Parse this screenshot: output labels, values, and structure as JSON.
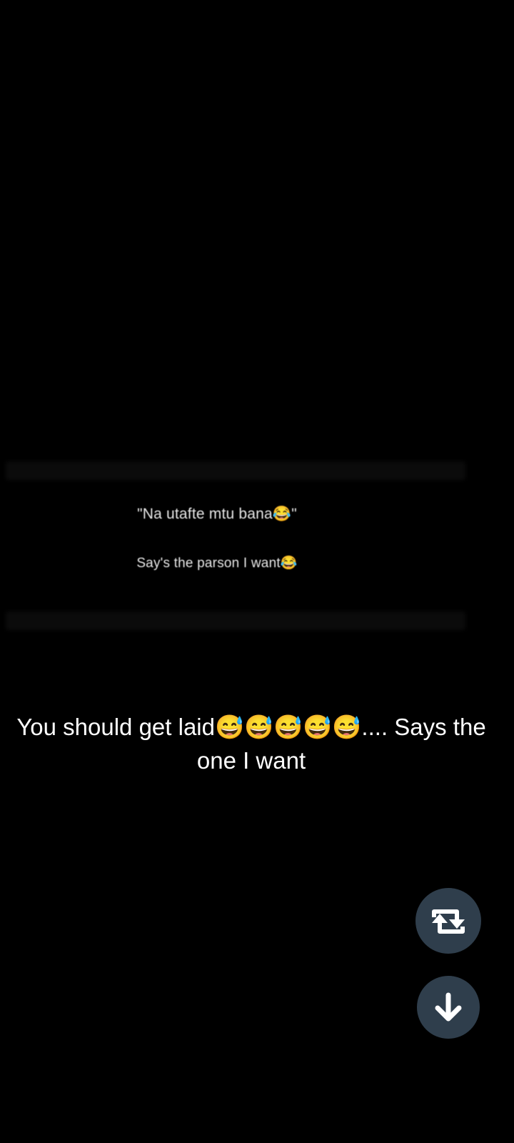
{
  "status_image": {
    "line1": "\"Na utafte mtu bana😂\"",
    "line2": "Say's the parson I want😂"
  },
  "caption": {
    "text": "You should get laid😅😅😅😅😅.... Says the one I want"
  },
  "buttons": {
    "repost_icon": "repost-icon",
    "download_icon": "arrow-down-icon"
  },
  "colors": {
    "background": "#000000",
    "button": "#2f3e4c",
    "text": "#ffffff"
  }
}
